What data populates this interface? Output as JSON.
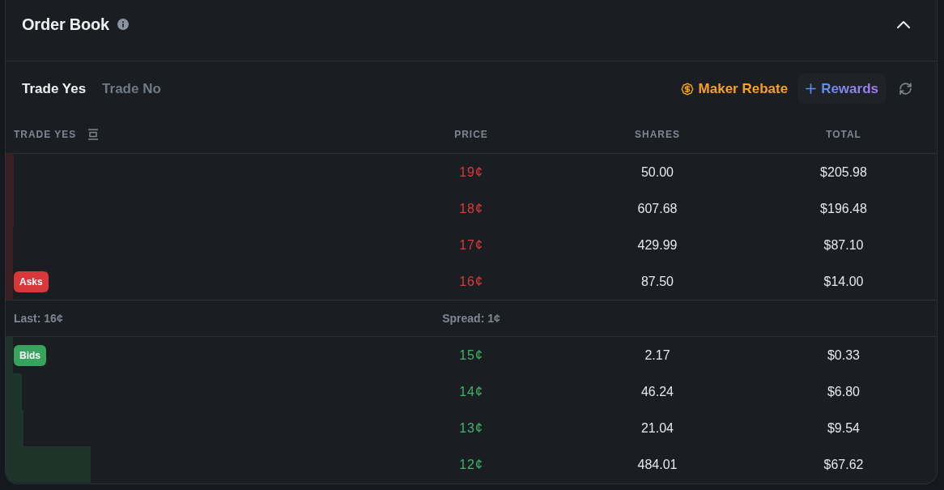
{
  "header": {
    "title": "Order Book",
    "expanded": true
  },
  "tabs": [
    {
      "label": "Trade Yes",
      "selected": true
    },
    {
      "label": "Trade No",
      "selected": false
    }
  ],
  "actions": [
    {
      "kind": "rebate",
      "label": "Maker Rebate"
    },
    {
      "kind": "rewards",
      "label": "Rewards"
    }
  ],
  "table": {
    "columns": [
      "TRADE YES",
      "PRICE",
      "SHARES",
      "TOTAL"
    ],
    "sections": [
      {
        "kind": "asks",
        "badge": "Asks",
        "rows": [
          {
            "price": "19¢",
            "shares": "50.00",
            "total": "$205.98",
            "level": 0.009
          },
          {
            "price": "18¢",
            "shares": "607.68",
            "total": "$196.48",
            "level": 0.009
          },
          {
            "price": "17¢",
            "shares": "429.99",
            "total": "$87.10",
            "level": 0.008
          },
          {
            "price": "16¢",
            "shares": "87.50",
            "total": "$14.00",
            "level": 0.008
          }
        ]
      },
      {
        "kind": "summary",
        "last": "Last: 16¢",
        "spread": "Spread: 1¢"
      },
      {
        "kind": "bids",
        "badge": "Bids",
        "rows": [
          {
            "price": "15¢",
            "shares": "2.17",
            "total": "$0.33",
            "level": 0.008
          },
          {
            "price": "14¢",
            "shares": "46.24",
            "total": "$6.80",
            "level": 0.017
          },
          {
            "price": "13¢",
            "shares": "21.04",
            "total": "$9.54",
            "level": 0.019
          },
          {
            "price": "12¢",
            "shares": "484.01",
            "total": "$67.62",
            "level": 0.091
          }
        ]
      }
    ]
  }
}
